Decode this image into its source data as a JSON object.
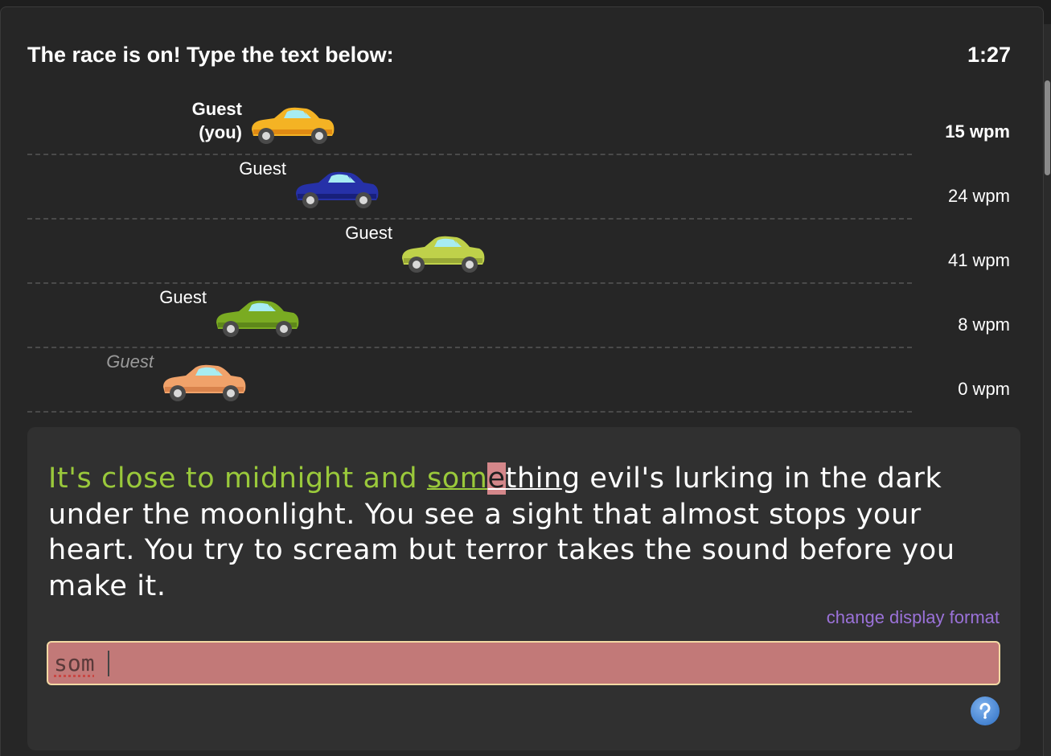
{
  "header": {
    "title": "The race is on! Type the text below:",
    "timer": "1:27"
  },
  "racers": [
    {
      "name_line1": "Guest",
      "name_line2": "(you)",
      "wpm": "15 wpm",
      "progress": 0.25,
      "color": "#f4b324",
      "accent": "#e08a13"
    },
    {
      "name_line1": "Guest",
      "name_line2": "",
      "wpm": "24 wpm",
      "progress": 0.3,
      "color": "#2631a8",
      "accent": "#18207a"
    },
    {
      "name_line1": "Guest",
      "name_line2": "",
      "wpm": "41 wpm",
      "progress": 0.42,
      "color": "#bfd14a",
      "accent": "#98a836"
    },
    {
      "name_line1": "Guest",
      "name_line2": "",
      "wpm": "8 wpm",
      "progress": 0.21,
      "color": "#7aab22",
      "accent": "#5e871a"
    },
    {
      "name_line1": "Guest",
      "name_line2": "",
      "wpm": "0 wpm",
      "progress": 0.15,
      "color": "#f0a26a",
      "accent": "#d9834c"
    }
  ],
  "passage": {
    "typed": "It's close to midnight and ",
    "typed_word_part": "som",
    "error_char": "e",
    "current_word_rest": "thin",
    "rest": "g evil's lurking in the dark under the moonlight. You see a sight that almost stops your heart. You try to scream but terror takes the sound before you make it."
  },
  "display_format_link": "change display format",
  "input": {
    "value": "som"
  },
  "colors": {
    "typed": "#9ac93b",
    "error": "#d4878a",
    "link": "#9b72d9",
    "input_bg": "#c27978"
  },
  "icons": {
    "help": "help-icon"
  }
}
